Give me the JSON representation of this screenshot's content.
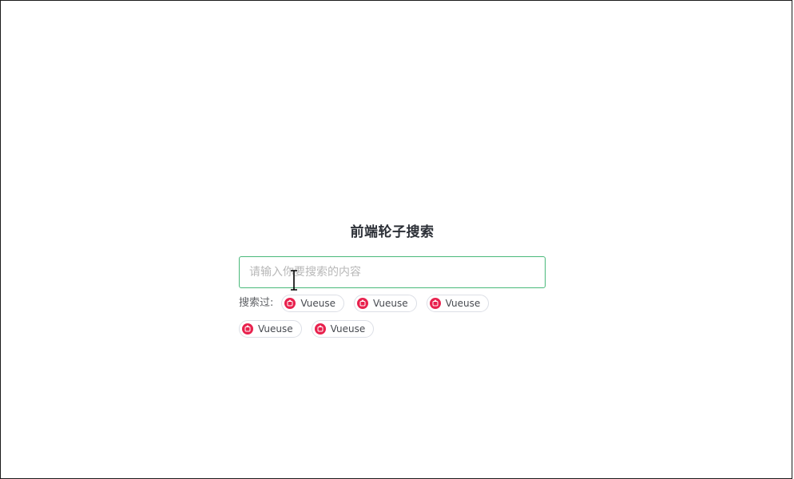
{
  "page": {
    "title": "前端轮子搜索"
  },
  "search": {
    "placeholder": "请输入你要搜索的内容",
    "value": ""
  },
  "history": {
    "label": "搜索过:",
    "items": [
      {
        "label": "Vueuse",
        "icon": "vueuse-logo-icon"
      },
      {
        "label": "Vueuse",
        "icon": "vueuse-logo-icon"
      },
      {
        "label": "Vueuse",
        "icon": "vueuse-logo-icon"
      },
      {
        "label": "Vueuse",
        "icon": "vueuse-logo-icon"
      },
      {
        "label": "Vueuse",
        "icon": "vueuse-logo-icon"
      }
    ]
  },
  "colors": {
    "accent_border": "#49b97a",
    "chip_icon": "#e8224e",
    "title_text": "#2b2f36"
  }
}
